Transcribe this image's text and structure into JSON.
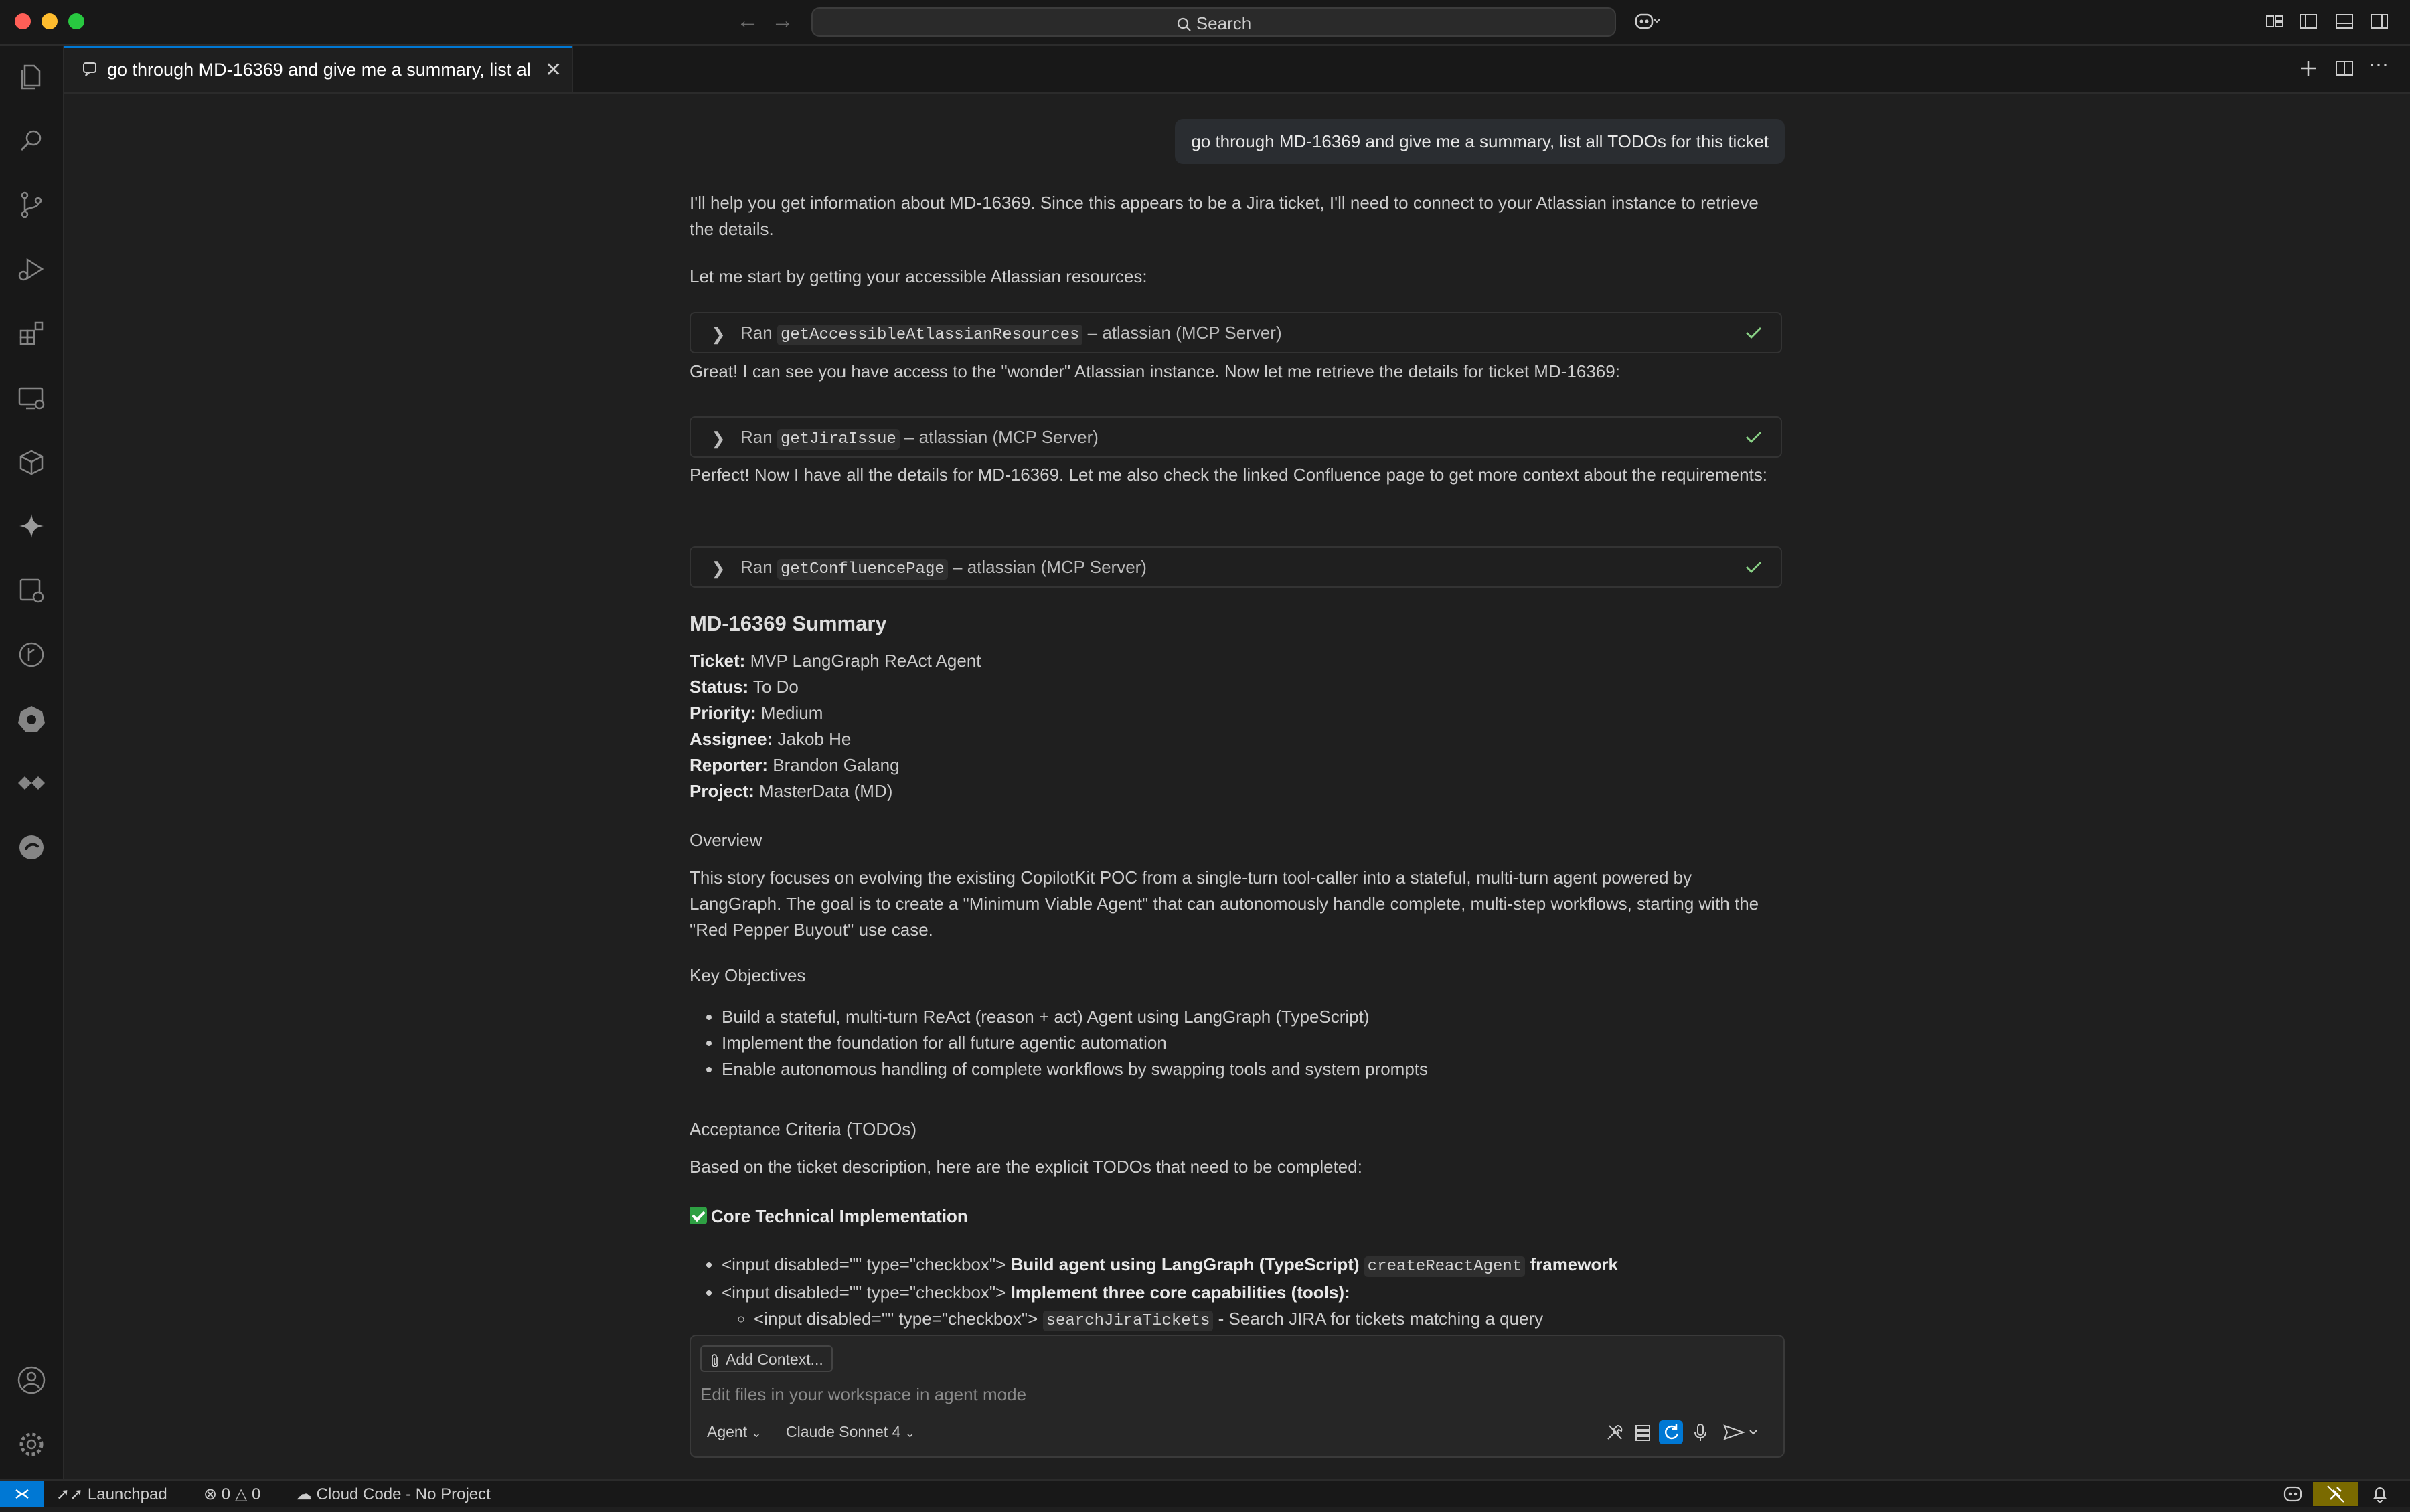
{
  "titlebar": {
    "search_label": "Search"
  },
  "tab": {
    "label": "go through MD-16369 and give me a summary, list al"
  },
  "chat": {
    "user_message": "go through MD-16369 and give me a summary, list all TODOs for this ticket",
    "intro": "I'll help you get information about MD-16369. Since this appears to be a Jira ticket, I'll need to connect to your Atlassian instance to retrieve the details.",
    "start": "Let me start by getting your accessible Atlassian resources:",
    "tool_ran_prefix": "Ran",
    "tool_server": "– atlassian (MCP Server)",
    "tool1": "getAccessibleAtlassianResources",
    "after_tool1": "Great! I can see you have access to the \"wonder\" Atlassian instance. Now let me retrieve the details for ticket MD-16369:",
    "tool2": "getJiraIssue",
    "after_tool2": "Perfect! Now I have all the details for MD-16369. Let me also check the linked Confluence page to get more context about the requirements:",
    "tool3": "getConfluencePage",
    "summary_heading": "MD-16369 Summary",
    "fields": [
      {
        "label": "Ticket:",
        "value": " MVP LangGraph ReAct Agent"
      },
      {
        "label": "Status:",
        "value": " To Do"
      },
      {
        "label": "Priority:",
        "value": " Medium"
      },
      {
        "label": "Assignee:",
        "value": " Jakob He"
      },
      {
        "label": "Reporter:",
        "value": " Brandon Galang"
      },
      {
        "label": "Project:",
        "value": " MasterData (MD)"
      }
    ],
    "overview_heading": "Overview",
    "overview_text": "This story focuses on evolving the existing CopilotKit POC from a single-turn tool-caller into a stateful, multi-turn agent powered by LangGraph. The goal is to create a \"Minimum Viable Agent\" that can autonomously handle complete, multi-step workflows, starting with the \"Red Pepper Buyout\" use case.",
    "objectives_heading": "Key Objectives",
    "objectives": [
      "Build a stateful, multi-turn ReAct (reason + act) Agent using LangGraph (TypeScript)",
      "Implement the foundation for all future agentic automation",
      "Enable autonomous handling of complete workflows by swapping tools and system prompts"
    ],
    "ac_heading": "Acceptance Criteria (TODOs)",
    "ac_intro": "Based on the ticket description, here are the explicit TODOs that need to be completed:",
    "core_heading": "Core Technical Implementation",
    "checkbox_html": "<input disabled=\"\" type=\"checkbox\">",
    "todo1_bold": "Build agent using LangGraph (TypeScript)",
    "todo1_code": "createReactAgent",
    "todo1_tail": "framework",
    "todo2_bold": "Implement three core capabilities (tools):",
    "subtodo1_code": "searchJiraTickets",
    "subtodo1_text": " - Search JIRA for tickets matching a query"
  },
  "input": {
    "add_context": "Add Context...",
    "placeholder": "Edit files in your workspace in agent mode",
    "mode": "Agent",
    "model": "Claude Sonnet 4"
  },
  "statusbar": {
    "launchpad": "Launchpad",
    "errors": "0",
    "warnings": "0",
    "cloud_code": "Cloud Code - No Project"
  },
  "colors": {
    "accent": "#0078d4",
    "check": "#89d185",
    "background": "#1f1f1f"
  }
}
